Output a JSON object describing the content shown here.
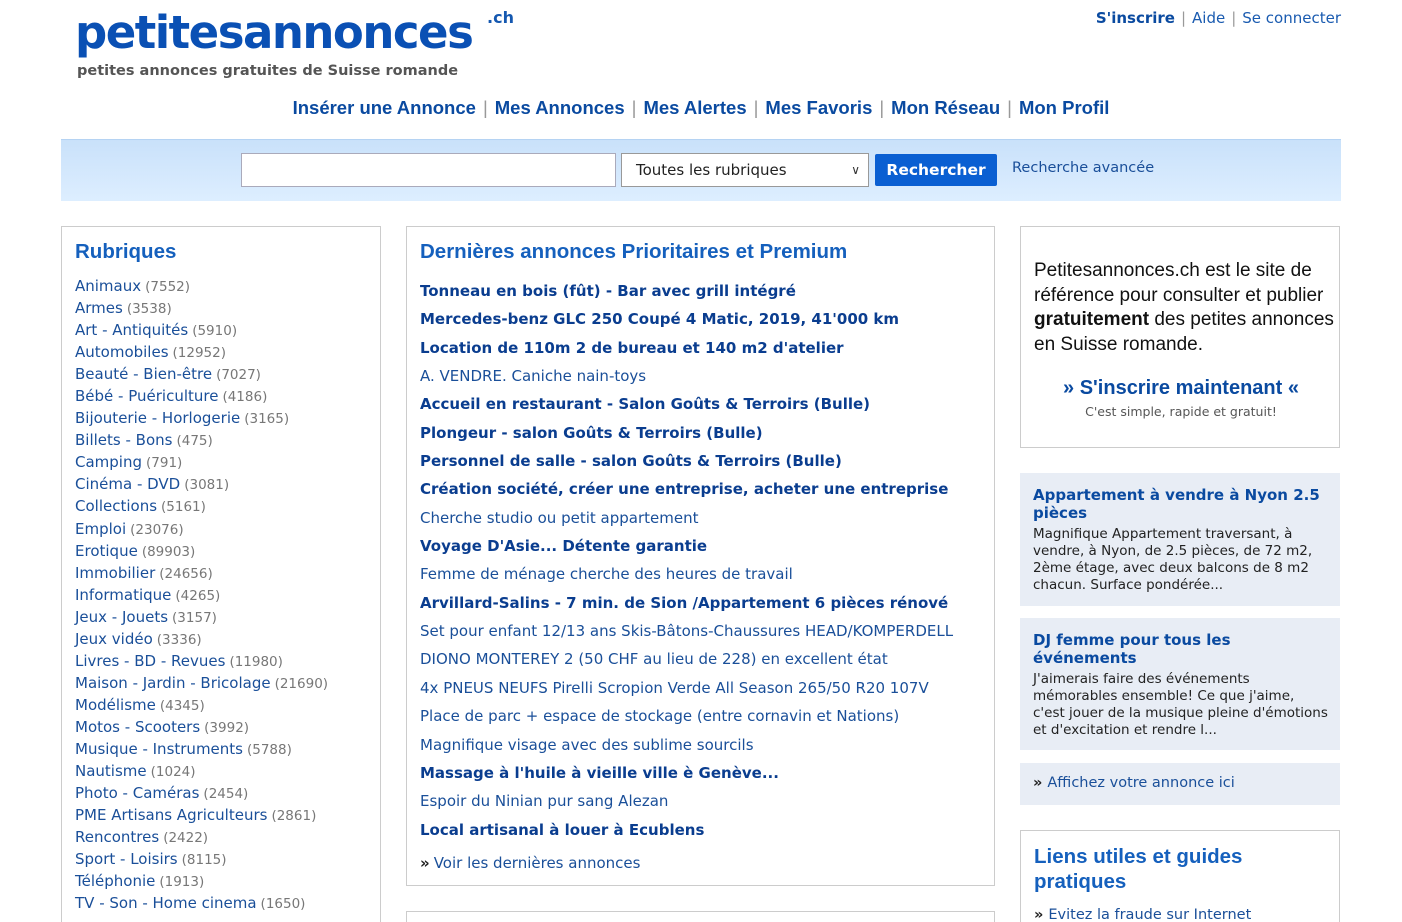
{
  "header": {
    "logo_text": "petitesannonces",
    "logo_suffix": ".ch",
    "tagline": "petites annonces gratuites de Suisse romande",
    "top_links": {
      "signup": "S'inscrire",
      "help": "Aide",
      "login": "Se connecter"
    },
    "nav": [
      "Insérer une Annonce",
      "Mes Annonces",
      "Mes Alertes",
      "Mes Favoris",
      "Mon Réseau",
      "Mon Profil"
    ]
  },
  "search": {
    "query": "",
    "category_selected": "Toutes les rubriques",
    "button_label": "Rechercher",
    "advanced_label": "Recherche avancée"
  },
  "rubriques": {
    "title": "Rubriques",
    "items": [
      {
        "name": "Animaux",
        "count": "(7552)"
      },
      {
        "name": "Armes",
        "count": "(3538)"
      },
      {
        "name": "Art - Antiquités",
        "count": "(5910)"
      },
      {
        "name": "Automobiles",
        "count": "(12952)"
      },
      {
        "name": "Beauté - Bien-être",
        "count": "(7027)"
      },
      {
        "name": "Bébé - Puériculture",
        "count": "(4186)"
      },
      {
        "name": "Bijouterie - Horlogerie",
        "count": "(3165)"
      },
      {
        "name": "Billets - Bons",
        "count": "(475)"
      },
      {
        "name": "Camping",
        "count": "(791)"
      },
      {
        "name": "Cinéma - DVD",
        "count": "(3081)"
      },
      {
        "name": "Collections",
        "count": "(5161)"
      },
      {
        "name": "Emploi",
        "count": "(23076)"
      },
      {
        "name": "Erotique",
        "count": "(89903)"
      },
      {
        "name": "Immobilier",
        "count": "(24656)"
      },
      {
        "name": "Informatique",
        "count": "(4265)"
      },
      {
        "name": "Jeux - Jouets",
        "count": "(3157)"
      },
      {
        "name": "Jeux vidéo",
        "count": "(3336)"
      },
      {
        "name": "Livres - BD - Revues",
        "count": "(11980)"
      },
      {
        "name": "Maison - Jardin - Bricolage",
        "count": "(21690)"
      },
      {
        "name": "Modélisme",
        "count": "(4345)"
      },
      {
        "name": "Motos - Scooters",
        "count": "(3992)"
      },
      {
        "name": "Musique - Instruments",
        "count": "(5788)"
      },
      {
        "name": "Nautisme",
        "count": "(1024)"
      },
      {
        "name": "Photo - Caméras",
        "count": "(2454)"
      },
      {
        "name": "PME Artisans Agriculteurs",
        "count": "(2861)"
      },
      {
        "name": "Rencontres",
        "count": "(2422)"
      },
      {
        "name": "Sport - Loisirs",
        "count": "(8115)"
      },
      {
        "name": "Téléphonie",
        "count": "(1913)"
      },
      {
        "name": "TV - Son - Home cinema",
        "count": "(1650)"
      }
    ]
  },
  "annonces": {
    "title": "Dernières annonces Prioritaires et Premium",
    "items": [
      {
        "text": "Tonneau en bois (fût) - Bar avec grill intégré",
        "bold": true
      },
      {
        "text": "Mercedes-benz GLC 250 Coupé 4 Matic, 2019, 41'000 km",
        "bold": true
      },
      {
        "text": "Location de 110m 2 de bureau et 140 m2 d'atelier",
        "bold": true
      },
      {
        "text": "A. VENDRE. Caniche nain-toys",
        "bold": false
      },
      {
        "text": "Accueil en restaurant - Salon Goûts & Terroirs (Bulle)",
        "bold": true
      },
      {
        "text": "Plongeur - salon Goûts & Terroirs (Bulle)",
        "bold": true
      },
      {
        "text": "Personnel de salle - salon Goûts & Terroirs (Bulle)",
        "bold": true
      },
      {
        "text": "Création société, créer une entreprise, acheter une entreprise",
        "bold": true
      },
      {
        "text": "Cherche studio ou petit appartement",
        "bold": false
      },
      {
        "text": "Voyage D'Asie... Détente garantie",
        "bold": true
      },
      {
        "text": "Femme de ménage cherche des heures de travail",
        "bold": false
      },
      {
        "text": "Arvillard-Salins - 7 min. de Sion /Appartement 6 pièces rénové",
        "bold": true
      },
      {
        "text": "Set pour enfant 12/13 ans Skis-Bâtons-Chaussures HEAD/KOMPERDELL",
        "bold": false
      },
      {
        "text": "DIONO MONTEREY 2 (50 CHF au lieu de 228) en excellent état",
        "bold": false
      },
      {
        "text": "4x PNEUS NEUFS Pirelli Scropion Verde All Season 265/50 R20 107V",
        "bold": false
      },
      {
        "text": "Place de parc + espace de stockage (entre cornavin et Nations)",
        "bold": false
      },
      {
        "text": "Magnifique visage avec des sublime sourcils",
        "bold": false
      },
      {
        "text": "Massage à l'huile à vieille ville è Genève...",
        "bold": true
      },
      {
        "text": "Espoir du Ninian pur sang Alezan",
        "bold": false
      },
      {
        "text": "Local artisanal à louer à Ecublens",
        "bold": true
      }
    ],
    "more_label": "Voir les dernières annonces"
  },
  "promo": {
    "text_before": "Petitesannonces.ch est le site de référence pour consulter et publier ",
    "text_bold": "gratuitement",
    "text_after": " des petites annonces en Suisse romande.",
    "cta": "» S'inscrire maintenant «",
    "subtitle": "C'est simple, rapide et gratuit!"
  },
  "featured": [
    {
      "title": "Appartement à vendre à Nyon 2.5 pièces",
      "body": "Magnifique Appartement traversant, à vendre, à Nyon, de 2.5 pièces, de 72 m2, 2ème étage, avec deux balcons de 8 m2 chacun. Surface pondérée..."
    },
    {
      "title": "DJ femme pour tous les événements",
      "body": "J'aimerais faire des événements mémorables ensemble! Ce que j'aime, c'est jouer de la musique pleine d'émotions et d'excitation et rendre l..."
    }
  ],
  "advertise_label": "Affichez votre annonce ici",
  "liens": {
    "title": "Liens utiles et guides pratiques",
    "first_item": "Evitez la fraude sur Internet"
  }
}
